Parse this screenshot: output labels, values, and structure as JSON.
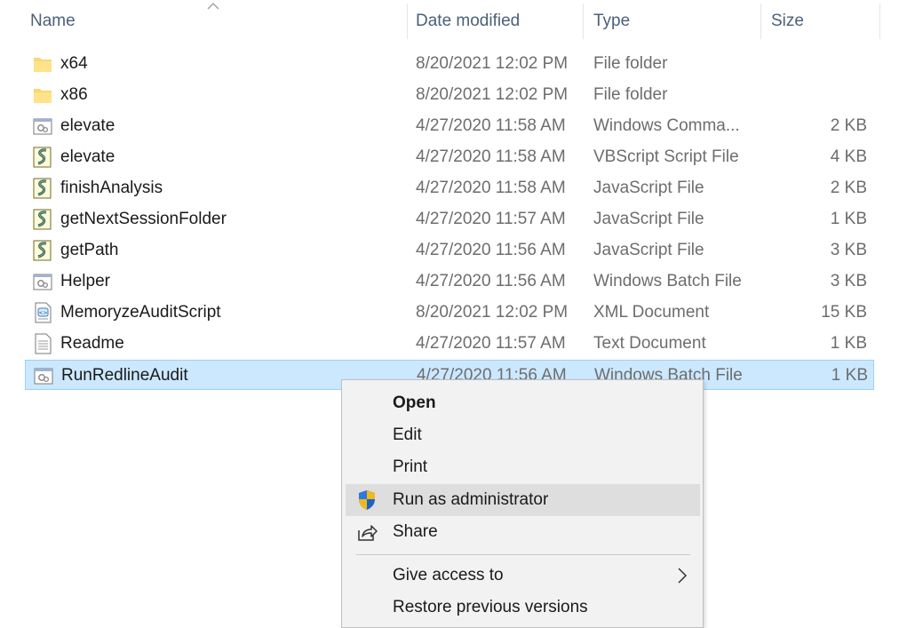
{
  "columns": {
    "name": "Name",
    "date_modified": "Date modified",
    "type": "Type",
    "size": "Size"
  },
  "files": [
    {
      "name": "x64",
      "date": "8/20/2021 12:02 PM",
      "type": "File folder",
      "size": "",
      "icon": "folder-icon"
    },
    {
      "name": "x86",
      "date": "8/20/2021 12:02 PM",
      "type": "File folder",
      "size": "",
      "icon": "folder-icon"
    },
    {
      "name": "elevate",
      "date": "4/27/2020 11:58 AM",
      "type": "Windows Comma...",
      "size": "2 KB",
      "icon": "batch-file-icon"
    },
    {
      "name": "elevate",
      "date": "4/27/2020 11:58 AM",
      "type": "VBScript Script File",
      "size": "4 KB",
      "icon": "script-file-icon"
    },
    {
      "name": "finishAnalysis",
      "date": "4/27/2020 11:58 AM",
      "type": "JavaScript File",
      "size": "2 KB",
      "icon": "script-file-icon"
    },
    {
      "name": "getNextSessionFolder",
      "date": "4/27/2020 11:57 AM",
      "type": "JavaScript File",
      "size": "1 KB",
      "icon": "script-file-icon"
    },
    {
      "name": "getPath",
      "date": "4/27/2020 11:56 AM",
      "type": "JavaScript File",
      "size": "3 KB",
      "icon": "script-file-icon"
    },
    {
      "name": "Helper",
      "date": "4/27/2020 11:56 AM",
      "type": "Windows Batch File",
      "size": "3 KB",
      "icon": "batch-file-icon"
    },
    {
      "name": "MemoryzeAuditScript",
      "date": "8/20/2021 12:02 PM",
      "type": "XML Document",
      "size": "15 KB",
      "icon": "xml-file-icon"
    },
    {
      "name": "Readme",
      "date": "4/27/2020 11:57 AM",
      "type": "Text Document",
      "size": "1 KB",
      "icon": "text-file-icon"
    },
    {
      "name": "RunRedlineAudit",
      "date": "4/27/2020 11:56 AM",
      "type": "Windows Batch File",
      "size": "1 KB",
      "icon": "batch-file-icon",
      "selected": true
    }
  ],
  "context_menu": {
    "open": "Open",
    "edit": "Edit",
    "print": "Print",
    "run_as_admin": "Run as administrator",
    "share": "Share",
    "give_access": "Give access to",
    "restore_versions": "Restore previous versions"
  },
  "colors": {
    "selection_bg": "#cce8ff",
    "selection_border": "#99d1ff",
    "header_text": "#4c607a",
    "menu_bg": "#f2f2f2",
    "menu_hover": "#dedede"
  }
}
